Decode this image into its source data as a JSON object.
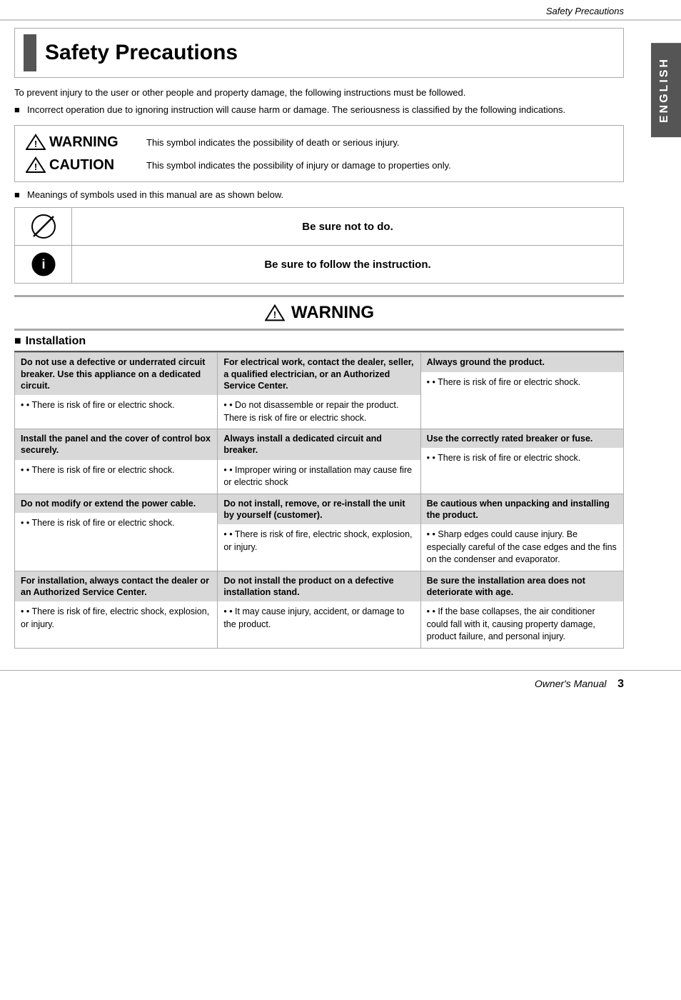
{
  "header": {
    "title": "Safety Precautions"
  },
  "right_tab": {
    "label": "ENGLISH"
  },
  "intro": {
    "text": "To prevent injury to the user or other people and property damage, the following instructions must be followed.",
    "bullet": "Incorrect operation due to ignoring instruction will cause harm or damage. The seriousness is classified by the following indications."
  },
  "warning_box": {
    "warning_label": "WARNING",
    "warning_desc": "This symbol indicates the possibility of death or serious injury.",
    "caution_label": "CAUTION",
    "caution_desc": "This symbol indicates the possibility of injury or damage to properties only."
  },
  "symbols_note": "Meanings of symbols used in this manual are as shown below.",
  "symbols": [
    {
      "text": "Be sure not to do."
    },
    {
      "text": "Be sure to follow the instruction."
    }
  ],
  "big_warning": "WARNING",
  "section_installation": "Installation",
  "grid": [
    {
      "title": "Do not use a defective or underrated circuit breaker. Use this appliance on a dedicated circuit.",
      "body": "• There is risk of fire or electric shock."
    },
    {
      "title": "For electrical work, contact the dealer, seller, a qualified electrician, or an Authorized Service Center.",
      "body": "• Do not disassemble or repair the product. There is risk of fire or electric shock."
    },
    {
      "title": "Always ground the product.",
      "body": "• There is risk of fire or electric shock."
    },
    {
      "title": "Install the panel and the cover of control box securely.",
      "body": "• There is risk of fire or electric shock."
    },
    {
      "title": "Always install a dedicated circuit and breaker.",
      "body": "• Improper wiring or installation may cause fire or electric shock"
    },
    {
      "title": "Use the correctly rated breaker or fuse.",
      "body": "• There is risk of fire or electric shock."
    },
    {
      "title": "Do not modify or extend the power cable.",
      "body": "• There is risk of fire or electric shock."
    },
    {
      "title": "Do not install, remove, or re-install the unit by yourself (customer).",
      "body": "• There is risk of fire, electric shock, explosion, or injury."
    },
    {
      "title": "Be cautious when unpacking and installing  the product.",
      "body": "• Sharp edges could cause injury. Be especially careful of the case edges and the fins on the condenser and evaporator."
    },
    {
      "title": "For installation, always contact the dealer or an Authorized Service Center.",
      "body": "• There is risk of fire, electric shock, explosion, or injury."
    },
    {
      "title": "Do not install the product on a defective installation stand.",
      "body": "• It may cause injury, accident, or damage to the product."
    },
    {
      "title": "Be sure the installation area does not deteriorate with age.",
      "body": "• If the base collapses, the air conditioner could fall with it, causing property damage, product failure, and personal injury."
    }
  ],
  "footer": {
    "label": "Owner's Manual",
    "page": "3"
  }
}
